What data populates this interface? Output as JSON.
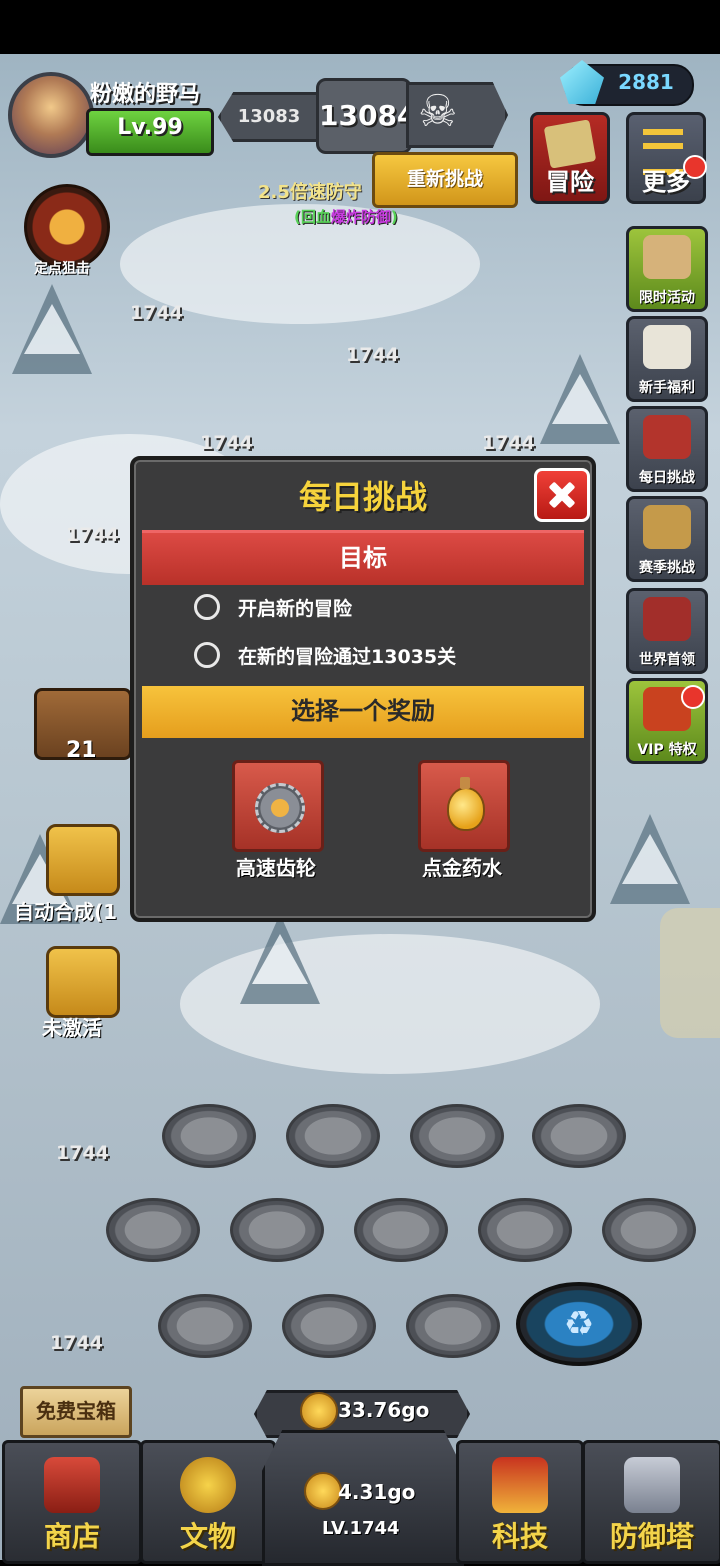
{
  "player": {
    "name": "粉嫩的野马",
    "level": "Lv.99"
  },
  "stage": {
    "previous": "13083",
    "current": "13084"
  },
  "retry_label": "重新挑战",
  "speed": {
    "text": "2.5倍速防守",
    "sub_prefix": "(回血",
    "sub_highlight": "爆炸防御",
    "sub_suffix": ")"
  },
  "gems": "2881",
  "top_buttons": {
    "adventure": "冒险",
    "more": "更多"
  },
  "side_buttons": [
    {
      "label": "限时活动"
    },
    {
      "label": "新手福利"
    },
    {
      "label": "每日挑战"
    },
    {
      "label": "赛季挑战"
    },
    {
      "label": "世界首领"
    },
    {
      "label": "VIP 特权"
    }
  ],
  "left_features": {
    "snipe": "定点狙击",
    "chest_count": "21",
    "auto_merge": "自动合成(1",
    "inactive": "未激活"
  },
  "tower_level": "1744",
  "dialog": {
    "title": "每日挑战",
    "goal_header": "目标",
    "goals": [
      "开启新的冒险",
      "在新的冒险通过13035关"
    ],
    "reward_header": "选择一个奖励",
    "rewards": [
      "高速齿轮",
      "点金药水"
    ]
  },
  "free_chest": "免费宝箱",
  "gold_rate": "33.76go",
  "center_gold": "4.31go",
  "center_level": "LV.1744",
  "nav": {
    "shop": "商店",
    "artifact": "文物",
    "tech": "科技",
    "defense": "防御塔"
  },
  "colors": {
    "title_yellow": "#f6d33c",
    "banner_red": "#dc4a44",
    "banner_yellow": "#f7c33c",
    "nav_gold": "#f3d44a"
  }
}
